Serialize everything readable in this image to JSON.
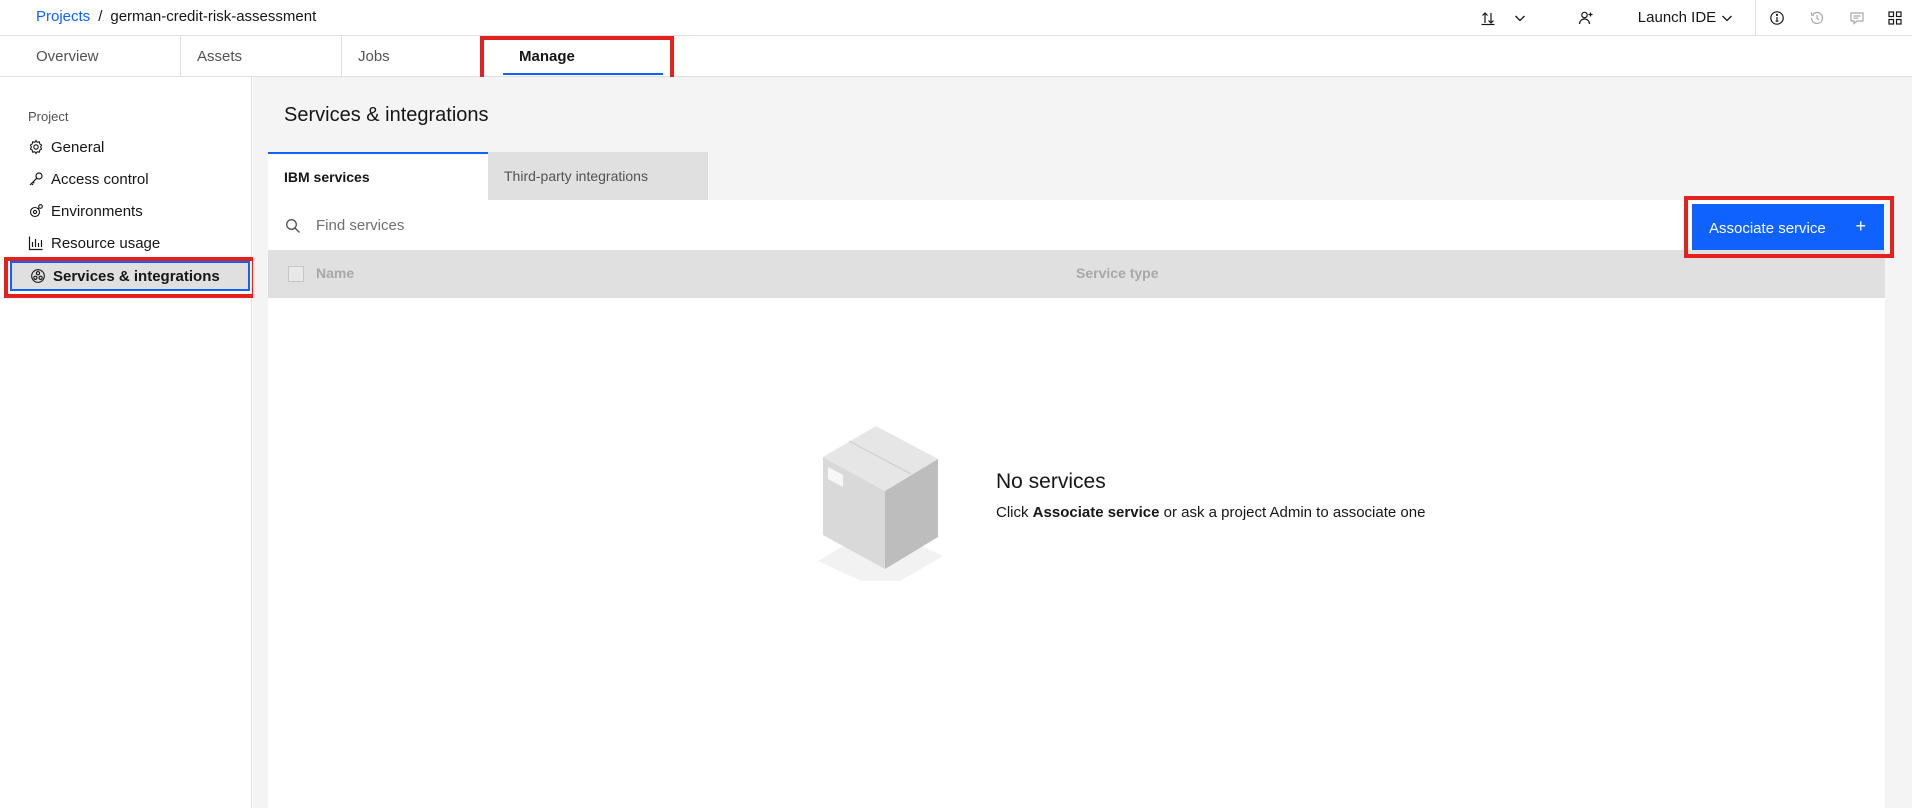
{
  "breadcrumb": {
    "parent": "Projects",
    "separator": "/",
    "current": "german-credit-risk-assessment"
  },
  "header_actions": {
    "launch_ide": "Launch IDE",
    "icons": [
      "upload-download-icon",
      "chevron-down-icon",
      "add-collaborator-icon",
      "chevron-down-icon",
      "info-icon",
      "history-icon",
      "comment-icon",
      "app-switcher-icon"
    ]
  },
  "project_tabs": [
    "Overview",
    "Assets",
    "Jobs",
    "Manage"
  ],
  "active_project_tab": "Manage",
  "sidebar": {
    "heading": "Project",
    "items": [
      {
        "label": "General",
        "icon": "settings-icon"
      },
      {
        "label": "Access control",
        "icon": "key-icon"
      },
      {
        "label": "Environments",
        "icon": "environment-icon"
      },
      {
        "label": "Resource usage",
        "icon": "chart-icon"
      },
      {
        "label": "Services & integrations",
        "icon": "services-icon"
      }
    ],
    "active_item": "Services & integrations"
  },
  "main": {
    "title": "Services & integrations",
    "tabs": [
      "IBM services",
      "Third-party integrations"
    ],
    "active_tab": "IBM services",
    "search": {
      "placeholder": "Find services"
    },
    "associate_button": {
      "label": "Associate service",
      "icon": "+"
    },
    "table": {
      "columns": [
        "Name",
        "Service type"
      ]
    },
    "empty_state": {
      "title": "No services",
      "text_prefix": "Click",
      "text_bold": "Associate service",
      "text_suffix": "or ask a project Admin to associate one"
    }
  },
  "colors": {
    "accent": "#0f62fe",
    "highlight": "#e5211e",
    "page_background": "#f4f4f4"
  }
}
